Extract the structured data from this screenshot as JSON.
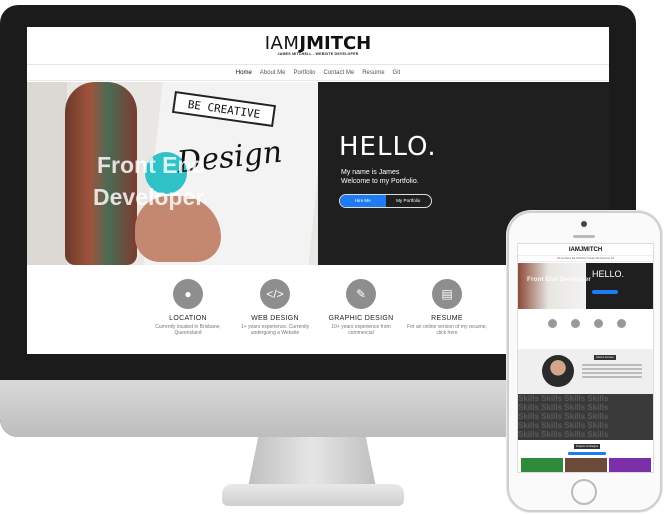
{
  "desktop": {
    "logo": {
      "part1": "IAM",
      "part2": "JMITCH",
      "subtitle": "JAMES MITCHELL - WEBSITE DEVELOPER"
    },
    "nav": [
      "Home",
      "About Me",
      "Portfolio",
      "Contact Me",
      "Resume",
      "Git"
    ],
    "hero": {
      "overlay_line1": "Front End",
      "overlay_line2": "Developer",
      "banner": "BE CREATIVE",
      "script_word": "Design",
      "hello": "HELLO.",
      "intro_line1": "My name is James",
      "intro_line2": "Welcome to my Portfolio.",
      "primary_button": "Hire Me",
      "secondary_button": "My Portfolio"
    },
    "features": [
      {
        "icon": "location-icon",
        "glyph": "●",
        "title": "LOCATION",
        "desc": "Currently located in Brisbane, Queensland"
      },
      {
        "icon": "code-icon",
        "glyph": "</>",
        "title": "WEB DESIGN",
        "desc": "1+ years experience. Currently undergoing a Website"
      },
      {
        "icon": "pen-icon",
        "glyph": "✎",
        "title": "GRAPHIC DESIGN",
        "desc": "10+ years experience from commercial"
      },
      {
        "icon": "document-icon",
        "glyph": "▤",
        "title": "RESUME",
        "desc": "For an online version of my resume, click here"
      }
    ]
  },
  "phone": {
    "logo": "IAMJMITCH",
    "nav": "Home  About Me  Portfolio  Contact Me  Resume  Git",
    "hero_overlay": "Front End Developer",
    "hello": "HELLO.",
    "about_title": "About James",
    "skills_word": "Skills",
    "projects_title": "Projects & Designs"
  },
  "colors": {
    "accent": "#1e7bf3",
    "hero_bg": "#1f1f1f",
    "teal": "#2fc2c6"
  }
}
